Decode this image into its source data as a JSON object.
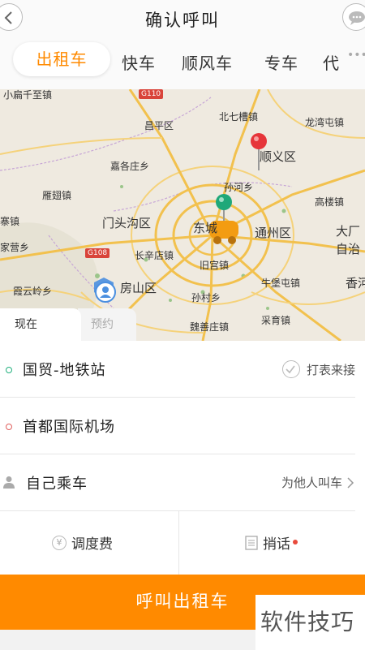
{
  "header": {
    "title": "确认呼叫",
    "back_icon": "chevron-left-icon",
    "message_icon": "chat-bubble-icon"
  },
  "tabs": [
    {
      "label": "出租车",
      "active": true
    },
    {
      "label": "快车",
      "active": false
    },
    {
      "label": "顺风车",
      "active": false
    },
    {
      "label": "专车",
      "active": false
    },
    {
      "label": "代",
      "active": false
    }
  ],
  "map": {
    "labels": {
      "changping": "昌平区",
      "beiqijia": "北七槽镇",
      "longwantun": "龙湾屯镇",
      "shunyi": "顺义区",
      "jiazhuang": "嘉各庄乡",
      "sunhe": "孙河乡",
      "yanchi": "雁翅镇",
      "gaoli": "高楼镇",
      "mentougou": "门头沟区",
      "dongcheng": "东城",
      "tongzhou": "通州区",
      "dachang": "大厂",
      "zizhi": "自治",
      "zhai": "寨镇",
      "jiaying": "家营乡",
      "changxindian": "长辛店镇",
      "jiugong": "旧宫镇",
      "niubao": "牛堡屯镇",
      "xianghe": "香河",
      "xiayunling": "霞云岭乡",
      "fangshan": "房山区",
      "sunjia": "孙村乡",
      "caiyu": "采育镇",
      "yushan": "魏善庄镇",
      "top_left": "小扁千至镇"
    },
    "road_badges": {
      "g110": "G110",
      "g108": "G108"
    },
    "colors": {
      "pickup_pin": "#1fa879",
      "dest_pin": "#e6353a",
      "taxi": "#f39c12"
    }
  },
  "time_tabs": {
    "now": "现在",
    "book": "预约"
  },
  "pickup": {
    "text": "国贸-地铁站",
    "dot_color": "#22b07d"
  },
  "meter": {
    "label": "打表来接"
  },
  "destination": {
    "text": "首都国际机场",
    "dot_color": "#e0605e"
  },
  "rider": {
    "label": "自己乘车",
    "for_other": "为他人叫车"
  },
  "fee": {
    "label": "调度费",
    "icon_text": "¥"
  },
  "note": {
    "label": "捎话"
  },
  "call_button": {
    "label": "呼叫出租车",
    "color": "#ff8a00"
  },
  "watermark": {
    "text": "软件技巧"
  }
}
